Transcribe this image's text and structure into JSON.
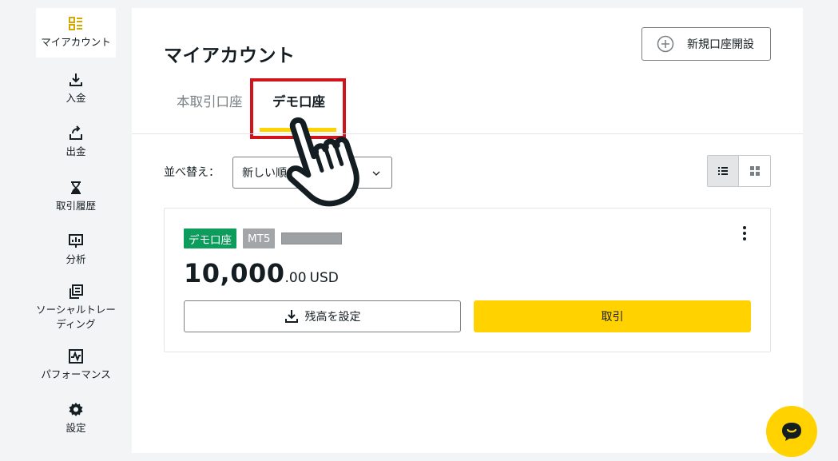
{
  "sidebar": {
    "items": [
      {
        "label": "マイアカウント",
        "icon": "dashboard-icon",
        "active": true
      },
      {
        "label": "入金",
        "icon": "download-icon"
      },
      {
        "label": "出金",
        "icon": "upload-icon"
      },
      {
        "label": "取引履歴",
        "icon": "hourglass-icon"
      },
      {
        "label": "分析",
        "icon": "analytics-icon"
      },
      {
        "label": "ソーシャルトレーディング",
        "icon": "copy-icon"
      },
      {
        "label": "パフォーマンス",
        "icon": "chart-line-icon"
      },
      {
        "label": "設定",
        "icon": "gear-icon"
      }
    ]
  },
  "header": {
    "title": "マイアカウント",
    "new_account_label": "新規口座開設"
  },
  "tabs": {
    "real_label": "本取引口座",
    "demo_label": "デモ口座",
    "active": "demo"
  },
  "toolbar": {
    "sort_label": "並べ替え：",
    "sort_value": "新しい順"
  },
  "account": {
    "type_badge": "デモ口座",
    "platform_badge": "MT5",
    "balance_main": "10,000",
    "balance_cents": ".00",
    "currency": "USD",
    "set_balance_label": "残高を設定",
    "trade_label": "取引"
  },
  "colors": {
    "accent": "#ffd200",
    "demo_badge": "#0c9d5c",
    "highlight": "#d0141c",
    "background": "#f3f4f6"
  }
}
